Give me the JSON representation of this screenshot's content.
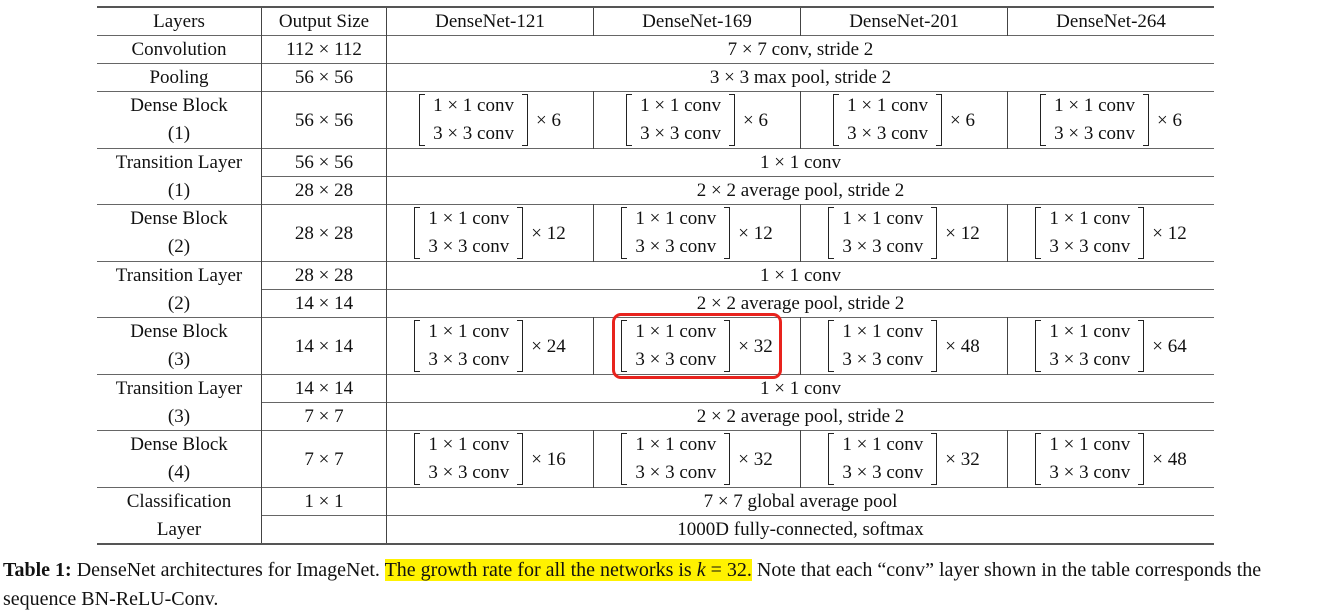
{
  "table": {
    "headers": [
      "Layers",
      "Output Size",
      "DenseNet-121",
      "DenseNet-169",
      "DenseNet-201",
      "DenseNet-264"
    ],
    "rows": {
      "conv": {
        "layer": "Convolution",
        "size": "112 × 112",
        "spec": "7 × 7 conv, stride 2"
      },
      "pool": {
        "layer": "Pooling",
        "size": "56 × 56",
        "spec": "3 × 3 max pool, stride 2"
      },
      "db1": {
        "layer_a": "Dense Block",
        "layer_b": "(1)",
        "size": "56 × 56",
        "reps": [
          "× 6",
          "× 6",
          "× 6",
          "× 6"
        ]
      },
      "tl1": {
        "layer_a": "Transition Layer",
        "layer_b": "(1)",
        "size_a": "56 × 56",
        "size_b": "28 × 28",
        "spec_a": "1 × 1 conv",
        "spec_b": "2 × 2 average pool, stride 2"
      },
      "db2": {
        "layer_a": "Dense Block",
        "layer_b": "(2)",
        "size": "28 × 28",
        "reps": [
          "× 12",
          "× 12",
          "× 12",
          "× 12"
        ]
      },
      "tl2": {
        "layer_a": "Transition Layer",
        "layer_b": "(2)",
        "size_a": "28 × 28",
        "size_b": "14 × 14",
        "spec_a": "1 × 1 conv",
        "spec_b": "2 × 2 average pool, stride 2"
      },
      "db3": {
        "layer_a": "Dense Block",
        "layer_b": "(3)",
        "size": "14 × 14",
        "reps": [
          "× 24",
          "× 32",
          "× 48",
          "× 64"
        ]
      },
      "tl3": {
        "layer_a": "Transition Layer",
        "layer_b": "(3)",
        "size_a": "14 × 14",
        "size_b": "7 × 7",
        "spec_a": "1 × 1 conv",
        "spec_b": "2 × 2 average pool, stride 2"
      },
      "db4": {
        "layer_a": "Dense Block",
        "layer_b": "(4)",
        "size": "7 × 7",
        "reps": [
          "× 16",
          "× 32",
          "× 32",
          "× 48"
        ]
      },
      "cls": {
        "layer_a": "Classification",
        "layer_b": "Layer",
        "size_a": "1 × 1",
        "size_b": "",
        "spec_a": "7 × 7 global average pool",
        "spec_b": "1000D fully-connected, softmax"
      }
    },
    "block_line1": "1 × 1 conv",
    "block_line2": "3 × 3 conv",
    "highlight_color": "#e8231d"
  },
  "caption": {
    "label": "Table 1:",
    "text1": " DenseNet architectures for ImageNet. ",
    "highlight_pre": "The growth rate for all the networks is ",
    "k": "k",
    "highlight_post": " = 32.",
    "text2": " Note that each “conv” layer shown in the table corresponds the sequence BN-ReLU-Conv.",
    "highlight_color": "#fff200"
  }
}
